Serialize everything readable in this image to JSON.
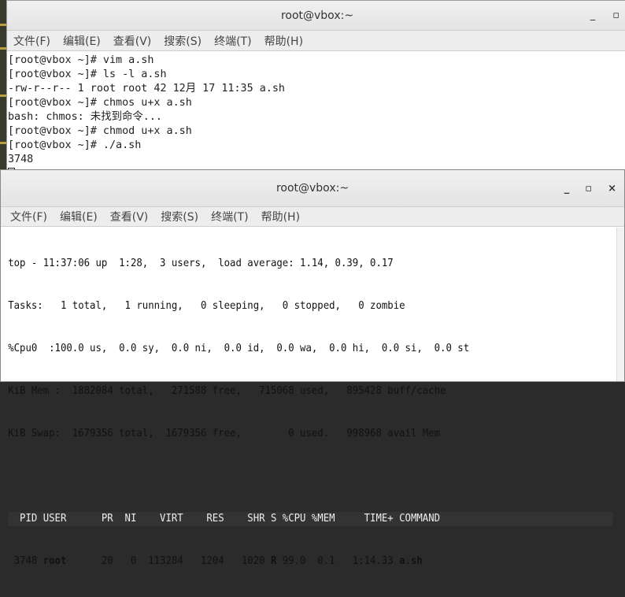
{
  "window1": {
    "title": "root@vbox:~",
    "menu": [
      "文件(F)",
      "编辑(E)",
      "查看(V)",
      "搜索(S)",
      "终端(T)",
      "帮助(H)"
    ],
    "lines": [
      "[root@vbox ~]# vim a.sh",
      "[root@vbox ~]# ls -l a.sh",
      "-rw-r--r-- 1 root root 42 12月 17 11:35 a.sh",
      "[root@vbox ~]# chmos u+x a.sh",
      "bash: chmos: 未找到命令...",
      "[root@vbox ~]# chmod u+x a.sh",
      "[root@vbox ~]# ./a.sh",
      "3748"
    ]
  },
  "window2": {
    "title": "root@vbox:~",
    "menu": [
      "文件(F)",
      "编辑(E)",
      "查看(V)",
      "搜索(S)",
      "终端(T)",
      "帮助(H)"
    ],
    "summary": [
      "top - 11:37:06 up  1:28,  3 users,  load average: 1.14, 0.39, 0.17",
      "Tasks:   1 total,   1 running,   0 sleeping,   0 stopped,   0 zombie",
      "%Cpu0  :100.0 us,  0.0 sy,  0.0 ni,  0.0 id,  0.0 wa,  0.0 hi,  0.0 si,  0.0 st",
      "KiB Mem :  1882084 total,   271588 free,   715068 used,   895428 buff/cache",
      "KiB Swap:  1679356 total,  1679356 free,        0 used.   998968 avail Mem"
    ],
    "header": "  PID USER      PR  NI    VIRT    RES    SHR S %CPU %MEM     TIME+ COMMAND",
    "row": {
      "pid": "3748",
      "user": "root",
      "mid": "      20   0  113284   1204   1020",
      "s": "R",
      "rest": " 99.0  0.1   1:14.33",
      "cmd": "a.sh"
    }
  },
  "controls": {
    "minimize": "_",
    "maximize": "▫",
    "close": "×"
  }
}
